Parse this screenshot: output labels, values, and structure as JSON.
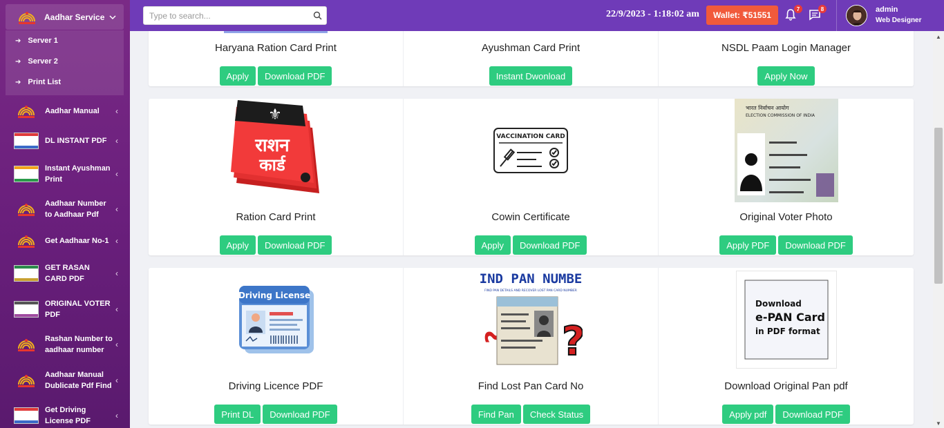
{
  "sidebar": {
    "active": {
      "label": "Aadhar Service",
      "icon": "aadhaar-logo-icon"
    },
    "submenu": [
      {
        "label": "Server 1"
      },
      {
        "label": "Server 2"
      },
      {
        "label": "Print List"
      }
    ],
    "items": [
      {
        "label": "Aadhar Manual",
        "icon": "aadhaar-logo-icon"
      },
      {
        "label": "DL INSTANT PDF",
        "icon": "driving-licence-card-icon"
      },
      {
        "label": "Instant Ayushman Print",
        "icon": "ayushman-card-icon"
      },
      {
        "label": "Aadhaar Number to Aadhaar Pdf",
        "icon": "aadhaar-logo-icon"
      },
      {
        "label": "Get Aadhaar No-1",
        "icon": "aadhaar-logo-icon"
      },
      {
        "label": "GET RASAN CARD PDF",
        "icon": "ration-card-icon"
      },
      {
        "label": "ORIGINAL VOTER PDF",
        "icon": "voter-card-icon"
      },
      {
        "label": "Rashan Number to aadhaar number",
        "icon": "aadhaar-logo-icon"
      },
      {
        "label": "Aadhaar Manual Dublicate Pdf Find",
        "icon": "aadhaar-logo-icon"
      },
      {
        "label": "Get Driving License PDF",
        "icon": "driving-licence-card-icon"
      }
    ]
  },
  "topbar": {
    "search_placeholder": "Type to search...",
    "datetime": "22/9/2023 - 1:18:02 am",
    "wallet": "Wallet: ₹51551",
    "notifications_count": "7",
    "messages_count": "8",
    "user_name": "admin",
    "user_role": "Web Designer"
  },
  "rows": [
    [
      {
        "title": "Haryana Ration Card Print",
        "buttons": [
          "Apply",
          "Download PDF"
        ]
      },
      {
        "title": "Ayushman Card Print",
        "buttons": [
          "Instant Dwonload"
        ]
      },
      {
        "title": "NSDL Paam Login Manager",
        "buttons": [
          "Apply Now"
        ]
      }
    ],
    [
      {
        "title": "Ration Card Print",
        "buttons": [
          "Apply",
          "Download PDF"
        ],
        "image_text": [
          "राशन",
          "कार्ड"
        ]
      },
      {
        "title": "Cowin Certificate",
        "buttons": [
          "Apply",
          "Download PDF"
        ],
        "image_text": [
          "VACCINATION CARD"
        ]
      },
      {
        "title": "Original Voter Photo",
        "buttons": [
          "Apply PDF",
          "Download PDF"
        ],
        "image_text": [
          "भारत निर्वाचन आयोग",
          "ELECTION COMMISSION OF INDIA"
        ]
      }
    ],
    [
      {
        "title": "Driving Licence PDF",
        "buttons": [
          "Print DL",
          "Download PDF"
        ],
        "image_text": [
          "Driving License"
        ]
      },
      {
        "title": "Find Lost Pan Card No",
        "buttons": [
          "Find Pan",
          "Check Status"
        ],
        "image_text": [
          "FIND PAN NUMBER",
          "FIND PAN DETAILS AND RECOVER LOST PAN CARD NUMBER"
        ]
      },
      {
        "title": "Download Original Pan pdf",
        "buttons": [
          "Apply pdf",
          "Download PDF"
        ],
        "image_text": [
          "Download",
          "e-PAN Card",
          "in PDF format"
        ]
      }
    ]
  ],
  "colors": {
    "topbar": "#6f3bb8",
    "sidebar": "#6a1f7c",
    "button": "#2ecc80",
    "wallet": "#f15a3b",
    "badge": "#e83a3a"
  }
}
